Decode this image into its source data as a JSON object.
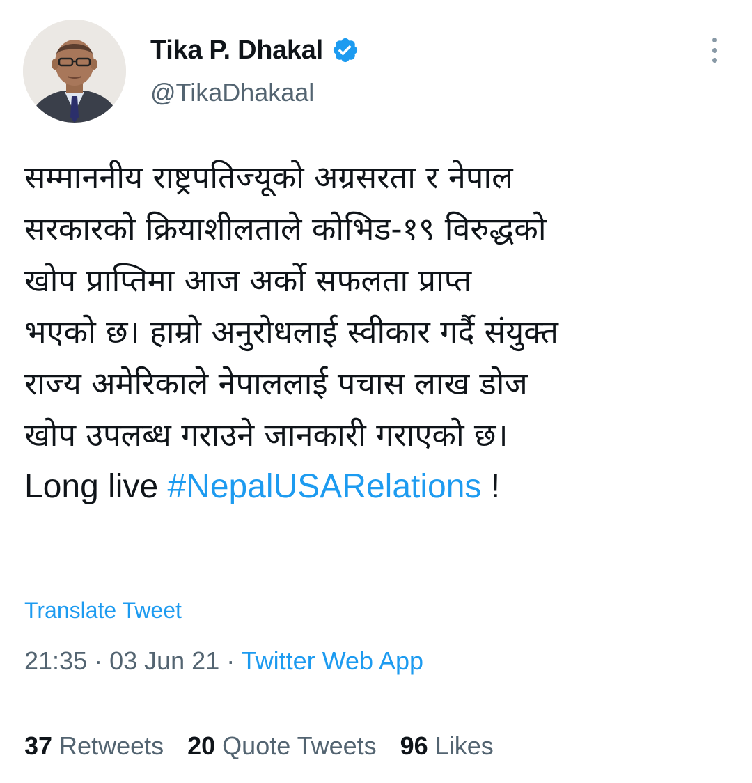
{
  "author": {
    "display_name": "Tika P. Dhakal",
    "handle": "@TikaDhakaal",
    "verified": true,
    "avatar_icon": "profile-photo"
  },
  "tweet": {
    "lines": [
      "सम्माननीय राष्ट्रपतिज्यूको अग्रसरता  र नेपाल",
      "सरकारको क्रियाशीलताले कोभिड-१९ विरुद्धको",
      "खोप प्राप्तिमा आज अर्को  सफलता प्राप्त",
      "भएको छ। हाम्रो अनुरोधलाई स्वीकार गर्दै संयुक्त",
      "राज्य अमेरिकाले नेपाललाई पचास लाख डोज",
      "खोप उपलब्ध गराउने जानकारी गराएको छ।"
    ],
    "last_line_prefix": "Long live ",
    "hashtag": "#NepalUSARelations",
    "last_line_suffix": " !"
  },
  "translate_label": "Translate Tweet",
  "meta": {
    "time": "21:35",
    "date": "03 Jun 21",
    "separator": " · ",
    "source": "Twitter Web App"
  },
  "stats": {
    "retweets": {
      "count": "37",
      "label": "Retweets"
    },
    "quotes": {
      "count": "20",
      "label": "Quote Tweets"
    },
    "likes": {
      "count": "96",
      "label": "Likes"
    }
  },
  "colors": {
    "accent": "#1d9bf0",
    "text": "#0f1419",
    "secondary": "#536471"
  }
}
